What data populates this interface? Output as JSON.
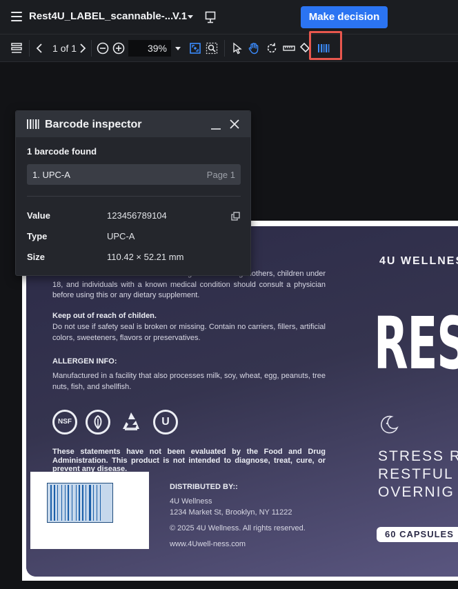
{
  "header": {
    "doc_title": "Rest4U_LABEL_scannable-...",
    "version": "V.1",
    "decision_label": "Make decision"
  },
  "toolbar": {
    "page_current": "1",
    "page_of": "of",
    "page_total": "1",
    "zoom": "39%",
    "icons": [
      "sidebar-icon",
      "chevron-left-icon",
      "chevron-right-icon",
      "zoom-out-icon",
      "zoom-in-icon",
      "zoom-dropdown-icon",
      "fit-page-icon",
      "zoom-select-icon",
      "pointer-icon",
      "hand-icon",
      "rotate-icon",
      "ruler-icon",
      "fill-icon",
      "barcode-icon"
    ],
    "accent": "#2b74f2",
    "highlight": "#e8574e"
  },
  "inspector": {
    "title": "Barcode inspector",
    "found": "1 barcode found",
    "item_label": "1. UPC-A",
    "item_page": "Page 1",
    "props": [
      {
        "key": "Value",
        "value": "123456789104"
      },
      {
        "key": "Type",
        "value": "UPC-A"
      },
      {
        "key": "Size",
        "value": "110.42 × 52.21 mm"
      }
    ]
  },
  "document": {
    "warning_text": "Do not exceed recommended dose. Pregnant or nursing mothers, children under 18, and individuals with a known medical condition should consult a physician before using this or any dietary supplement.",
    "keep_head": "Keep out of reach of childen.",
    "keep_text": "Do not use if safety seal is broken or missing. Contain no carriers, fillers, artificial colors, sweeteners, flavors or preservatives.",
    "allergen_head": "ALLERGEN INFO:",
    "allergen_text": "Manufactured in a facility that also processes milk, soy, wheat, egg, peanuts, tree nuts, fish, and shellfish.",
    "cert_nsf": "NSF",
    "cert_u": "U",
    "disclaimer": "These statements have not been evaluated by the Food and Drug Administration. This product is not intended to diagnose, treat, cure, or prevent any disease.",
    "dist_head": "DISTRIBUTED BY::",
    "dist_name": "4U Wellness",
    "dist_addr": "1234 Market St, Brooklyn, NY 11222",
    "copyright": "© 2025 4U Wellness. All rights reserved.",
    "website": "www.4Uwell-ness.com",
    "brand": "4U   WELLNES",
    "logo": "RES",
    "tagline": [
      "STRESS R",
      "RESTFUL",
      "OVERNIG"
    ],
    "capsules": "60 CAPSULES"
  }
}
